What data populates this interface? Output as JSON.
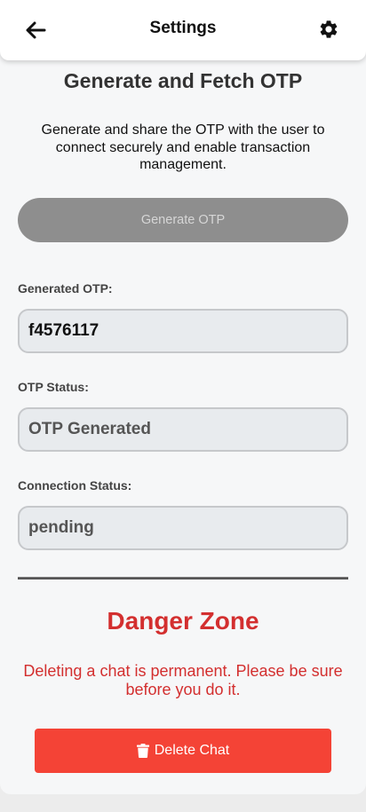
{
  "header": {
    "title": "Settings",
    "back_icon": "arrow-left-icon",
    "settings_icon": "gear-icon"
  },
  "otp": {
    "title": "Generate and Fetch OTP",
    "description": "Generate and share the OTP with the user to connect securely and enable transaction management.",
    "generate_button_label": "Generate OTP",
    "fields": [
      {
        "label": "Generated OTP:",
        "value": "f4576117"
      },
      {
        "label": "OTP Status:",
        "value": "OTP Generated"
      },
      {
        "label": "Connection Status:",
        "value": "pending"
      }
    ]
  },
  "danger": {
    "title": "Danger Zone",
    "description": "Deleting a chat is permanent. Please be sure before you do it.",
    "delete_button_label": "Delete Chat",
    "delete_icon": "trash-icon"
  },
  "colors": {
    "danger": "#d32f2f",
    "delete_button": "#f44336",
    "disabled_button": "#8e8e8e"
  }
}
